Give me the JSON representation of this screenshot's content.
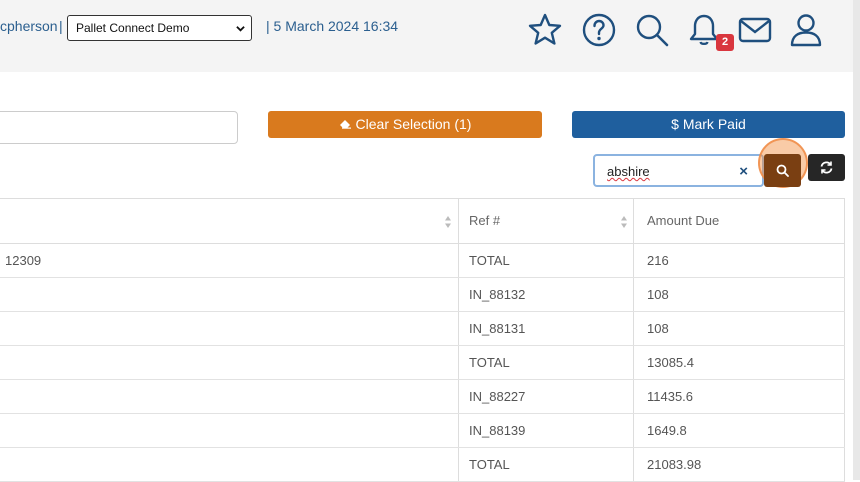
{
  "header": {
    "user_name": "cpherson",
    "separator": "|",
    "organization_select": "Pallet Connect Demo",
    "datetime": "| 5 March 2024 16:34",
    "icons": [
      "star-icon",
      "help-icon",
      "search-icon",
      "bell-icon",
      "mail-icon",
      "user-icon"
    ],
    "notification_count": "2"
  },
  "toolbar": {
    "clear_selection_label": "Clear Selection (1)",
    "mark_paid_label": "$ Mark Paid",
    "search_value": "abshire",
    "clear_search": "×"
  },
  "colors": {
    "clear_button": "#d97a1e",
    "mark_paid_button": "#1f5f9e",
    "search_button": "#7a3f12",
    "refresh_button": "#262626",
    "badge": "#d9363e",
    "link_text": "#2b5f8f"
  },
  "table": {
    "columns": [
      "",
      "Ref #",
      "Amount Due"
    ],
    "rows": [
      {
        "c1": "12309",
        "ref": "TOTAL",
        "amount": "216"
      },
      {
        "c1": "",
        "ref": "IN_88132",
        "amount": "108"
      },
      {
        "c1": "",
        "ref": "IN_88131",
        "amount": "108"
      },
      {
        "c1": "",
        "ref": "TOTAL",
        "amount": "13085.4"
      },
      {
        "c1": "",
        "ref": "IN_88227",
        "amount": "11435.6"
      },
      {
        "c1": "",
        "ref": "IN_88139",
        "amount": "1649.8"
      },
      {
        "c1": "",
        "ref": "TOTAL",
        "amount": "21083.98"
      }
    ]
  }
}
